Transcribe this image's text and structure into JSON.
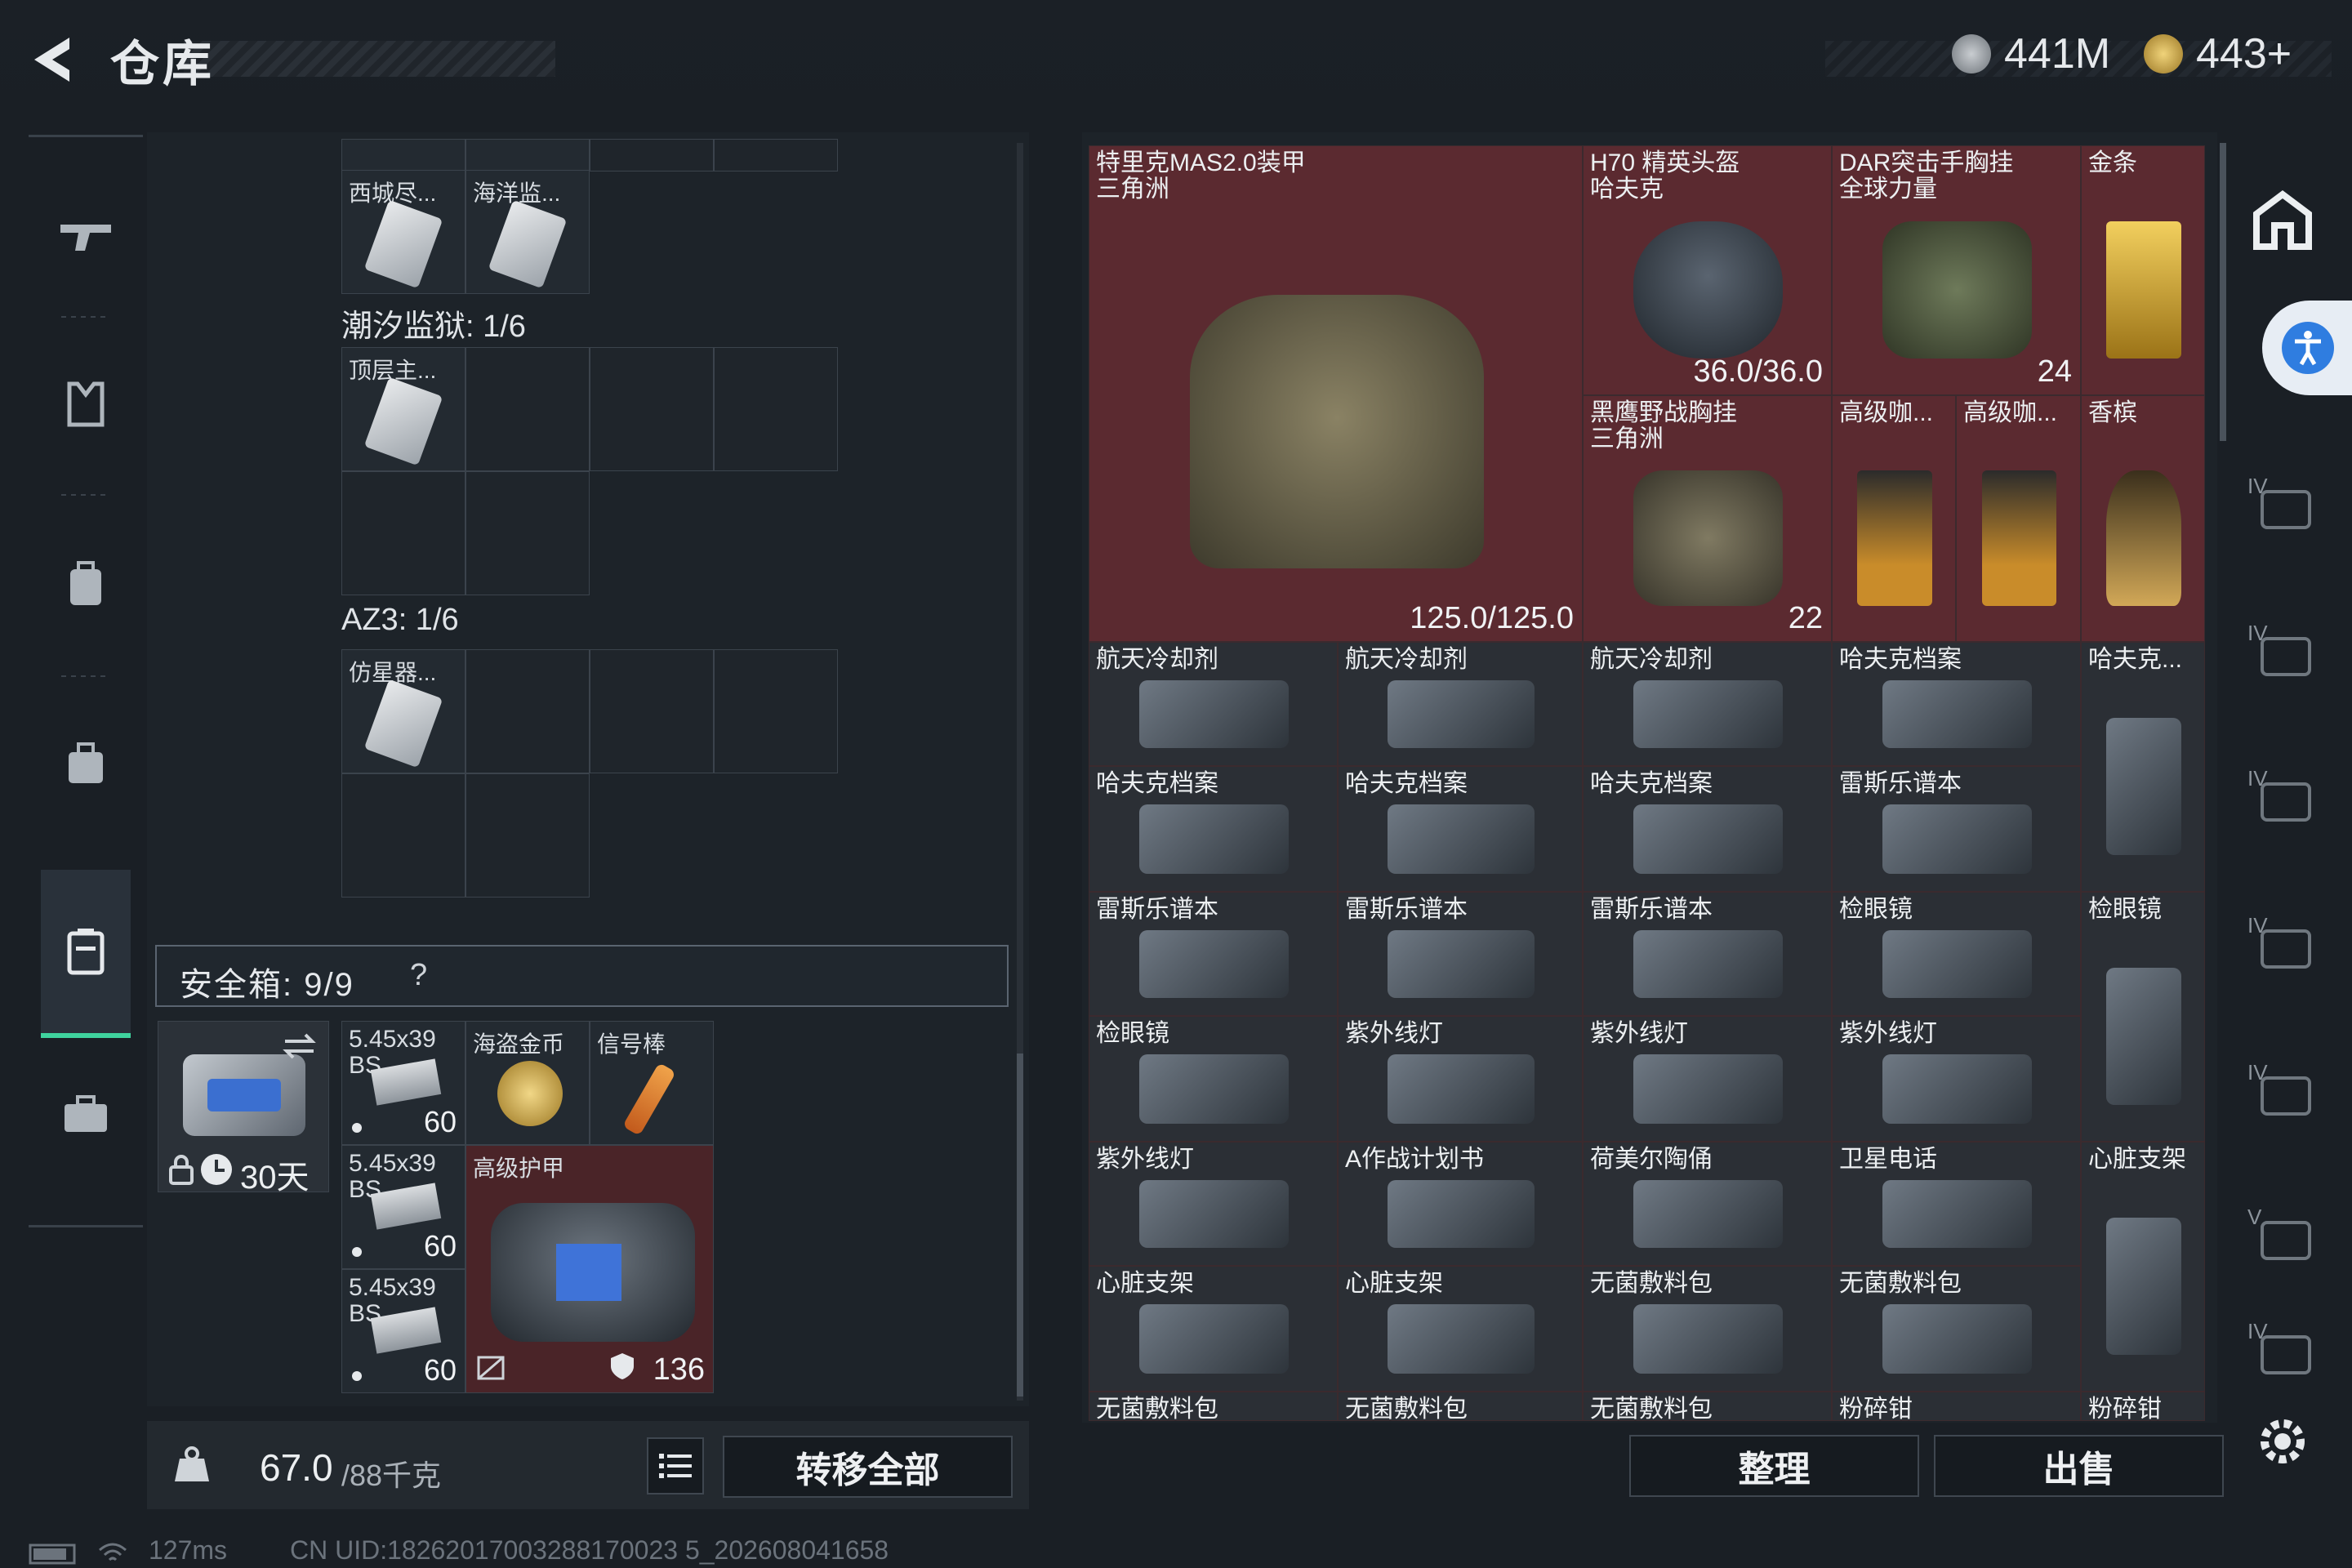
{
  "header": {
    "title": "仓库"
  },
  "currency": [
    {
      "icon": "silver-coin-icon",
      "value": "441M"
    },
    {
      "icon": "gold-coin-icon",
      "value": "443+"
    }
  ],
  "sidebar": {
    "items": [
      {
        "icon": "gun-icon"
      },
      {
        "icon": "armor-vest-icon"
      },
      {
        "icon": "backpack-icon"
      },
      {
        "icon": "bag-icon"
      },
      {
        "icon": "safebox-icon",
        "active": true
      },
      {
        "icon": "briefcase-icon"
      }
    ]
  },
  "left": {
    "top_partial_cells": [
      "西城尽...",
      "海洋监..."
    ],
    "section1": {
      "label": "潮汐监狱: 1/6",
      "item": "顶层主..."
    },
    "section2": {
      "label": "AZ3: 1/6",
      "item": "仿星器..."
    },
    "safebox": {
      "label": "安全箱: 9/9",
      "help": "?",
      "container_timer": "30天",
      "items": [
        {
          "name": "5.45x39 BS",
          "count": "60"
        },
        {
          "name": "海盗金币"
        },
        {
          "name": "信号棒"
        },
        {
          "name": "5.45x39 BS",
          "count": "60"
        },
        {
          "name": "高级护甲",
          "value": "136"
        },
        {
          "name": "5.45x39 BS",
          "count": "60"
        }
      ]
    }
  },
  "bottom": {
    "weight": "67.0",
    "weight_max": "/88千克",
    "transfer_all": "转移全部",
    "organize": "整理",
    "sell": "出售"
  },
  "stash": {
    "items": [
      {
        "name": "特里克MAS2.0装甲",
        "sub": "三角洲",
        "value": "125.0/125.0"
      },
      {
        "name": "H70 精英头盔",
        "sub": "哈夫克",
        "value": "36.0/36.0"
      },
      {
        "name": "DAR突击手胸挂",
        "sub": "全球力量",
        "value": "24"
      },
      {
        "name": "金条"
      },
      {
        "name": "黑鹰野战胸挂",
        "sub": "三角洲",
        "value": "22"
      },
      {
        "name": "高级咖..."
      },
      {
        "name": "高级咖..."
      },
      {
        "name": "香槟"
      },
      {
        "name": "航天冷却剂"
      },
      {
        "name": "航天冷却剂"
      },
      {
        "name": "航天冷却剂"
      },
      {
        "name": "哈夫克档案"
      },
      {
        "name": "哈夫克..."
      },
      {
        "name": "哈夫克档案"
      },
      {
        "name": "哈夫克档案"
      },
      {
        "name": "哈夫克档案"
      },
      {
        "name": "雷斯乐谱本"
      },
      {
        "name": "雷斯乐谱本"
      },
      {
        "name": "雷斯乐谱本"
      },
      {
        "name": "雷斯乐谱本"
      },
      {
        "name": "检眼镜"
      },
      {
        "name": "检眼镜"
      },
      {
        "name": "检眼镜"
      },
      {
        "name": "紫外线灯"
      },
      {
        "name": "紫外线灯"
      },
      {
        "name": "紫外线灯"
      },
      {
        "name": "紫外线灯"
      },
      {
        "name": "A作战计划书"
      },
      {
        "name": "荷美尔陶俑"
      },
      {
        "name": "卫星电话"
      },
      {
        "name": "心脏支架"
      },
      {
        "name": "心脏支架"
      },
      {
        "name": "心脏支架"
      },
      {
        "name": "无菌敷料包"
      },
      {
        "name": "无菌敷料包"
      },
      {
        "name": "无菌敷料包"
      },
      {
        "name": "无菌敷料包"
      },
      {
        "name": "无菌敷料包"
      },
      {
        "name": "粉碎钳"
      },
      {
        "name": "粉碎钳"
      }
    ]
  },
  "right_sidebar": {
    "tiers": [
      "IV",
      "IV",
      "IV",
      "IV",
      "IV",
      "V",
      "IV"
    ]
  },
  "status": {
    "ping": "127ms",
    "uid": "CN UID:18262017003288170023 5_202608041658"
  }
}
